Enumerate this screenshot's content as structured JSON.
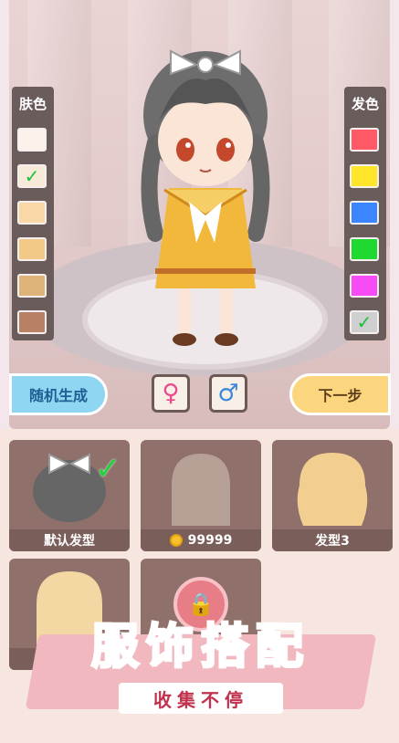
{
  "colors": {
    "skin_tones": [
      "#fbf2ec",
      "#f7ead8",
      "#fad7a7",
      "#f2c987",
      "#ddb37a",
      "#b88166"
    ],
    "hair_colors": [
      "#ff5a66",
      "#ffe62a",
      "#3b86ff",
      "#1fd930",
      "#f64cf5",
      "#cfcfcf"
    ],
    "check": "#19c23a",
    "promo_title": "#ee4f69",
    "promo_band": "#f2b8c0"
  },
  "left_palette": {
    "title": "肤色",
    "selected_index": 1,
    "check_icon": "checkmark-icon"
  },
  "right_palette": {
    "title": "发色",
    "selected_index": 5,
    "check_icon": "checkmark-icon"
  },
  "buttons": {
    "random": "随机生成",
    "female_icon": "♀",
    "male_icon": "♂",
    "next": "下一步"
  },
  "hair_items": [
    {
      "label": "默认发型",
      "selected": true
    },
    {
      "price": "99999",
      "currency_icon": "coin-icon"
    },
    {
      "label": "发型3"
    },
    {
      "label": ""
    },
    {
      "locked_icon": "lock-icon",
      "lock_symbol": "🔒"
    }
  ],
  "promo": {
    "title": "服饰搭配",
    "subtitle": "收集不停"
  }
}
